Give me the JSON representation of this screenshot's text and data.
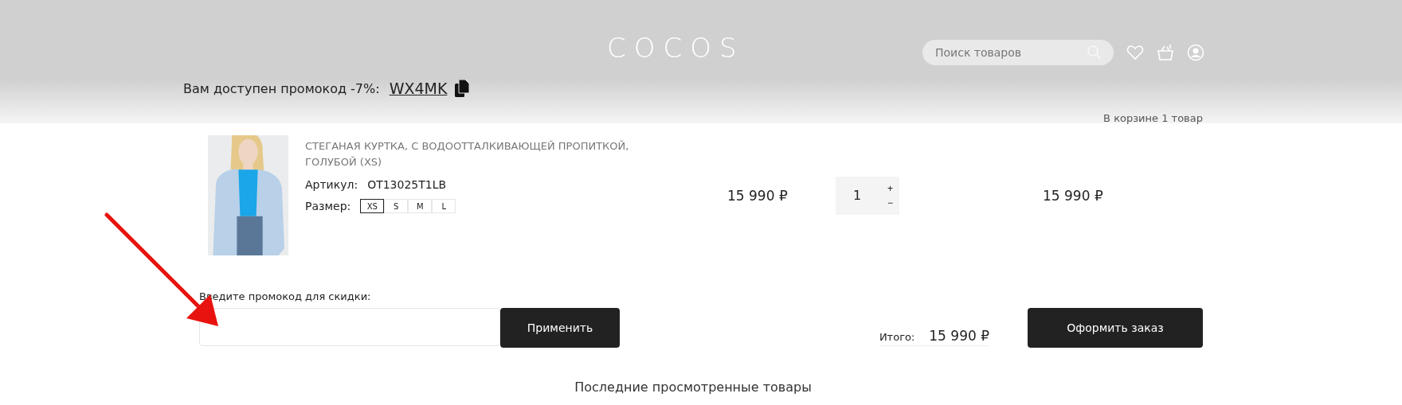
{
  "header": {
    "logo": "COCOS",
    "search": {
      "placeholder": "Поиск товаров"
    }
  },
  "promo": {
    "label": "Вам доступен промокод -7%:",
    "code": "WX4MK"
  },
  "cart_count": "В корзине 1 товар",
  "items": [
    {
      "kind": "picture",
      "title": "СТЕГАНАЯ КУРТКА, С ВОДООТТАЛКИВАЮЩЕЙ ПРОПИТКОЙ, ГОЛУБОЙ (XS)",
      "article_label": "Артикул:",
      "article": "OT13025T1LB",
      "size_label": "Размер:",
      "sizes": [
        {
          "label": "XS",
          "selected": true
        },
        {
          "label": "S",
          "selected": false
        },
        {
          "label": "M",
          "selected": false
        },
        {
          "label": "L",
          "selected": false
        }
      ],
      "price": "15 990 ₽",
      "quantity": "1",
      "plus": "+",
      "minus": "−",
      "sum": "15 990 ₽"
    }
  ],
  "promo_form": {
    "label": "Введите промокод для скидки:",
    "button": "Применить"
  },
  "total": {
    "label": "Итого:",
    "value": "15 990 ₽"
  },
  "checkout_button": "Оформить заказ",
  "recent_heading": "Последние просмотренные товары"
}
